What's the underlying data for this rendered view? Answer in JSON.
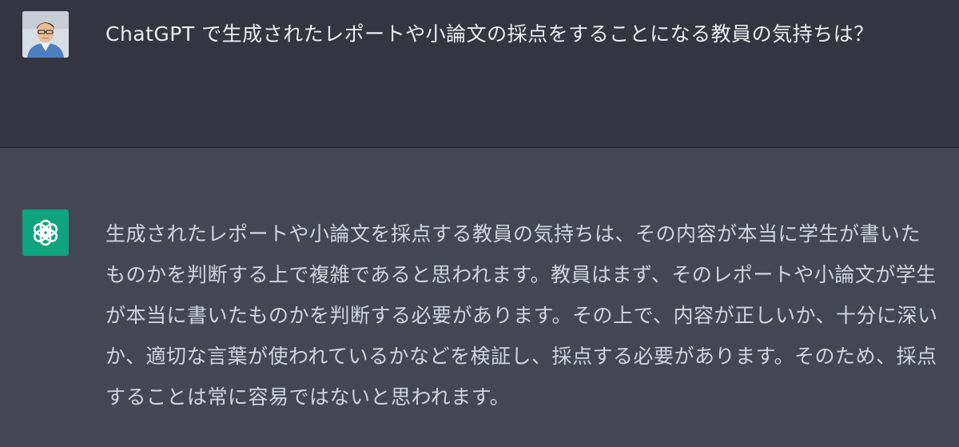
{
  "conversation": {
    "user": {
      "avatar_icon": "user-photo-avatar",
      "message": "ChatGPT で生成されたレポートや小論文の採点をすることになる教員の気持ちは？"
    },
    "assistant": {
      "avatar_icon": "openai-logo-icon",
      "avatar_color": "#10a37f",
      "message": "生成されたレポートや小論文を採点する教員の気持ちは、その内容が本当に学生が書いたものかを判断する上で複雑であると思われます。教員はまず、そのレポートや小論文が学生が本当に書いたものかを判断する必要があります。その上で、内容が正しいか、十分に深いか、適切な言葉が使われているかなどを検証し、採点する必要があります。そのため、採点することは常に容易ではないと思われます。"
    }
  },
  "colors": {
    "user_bg": "#343541",
    "assistant_bg": "#444654",
    "text": "#ececf1"
  }
}
